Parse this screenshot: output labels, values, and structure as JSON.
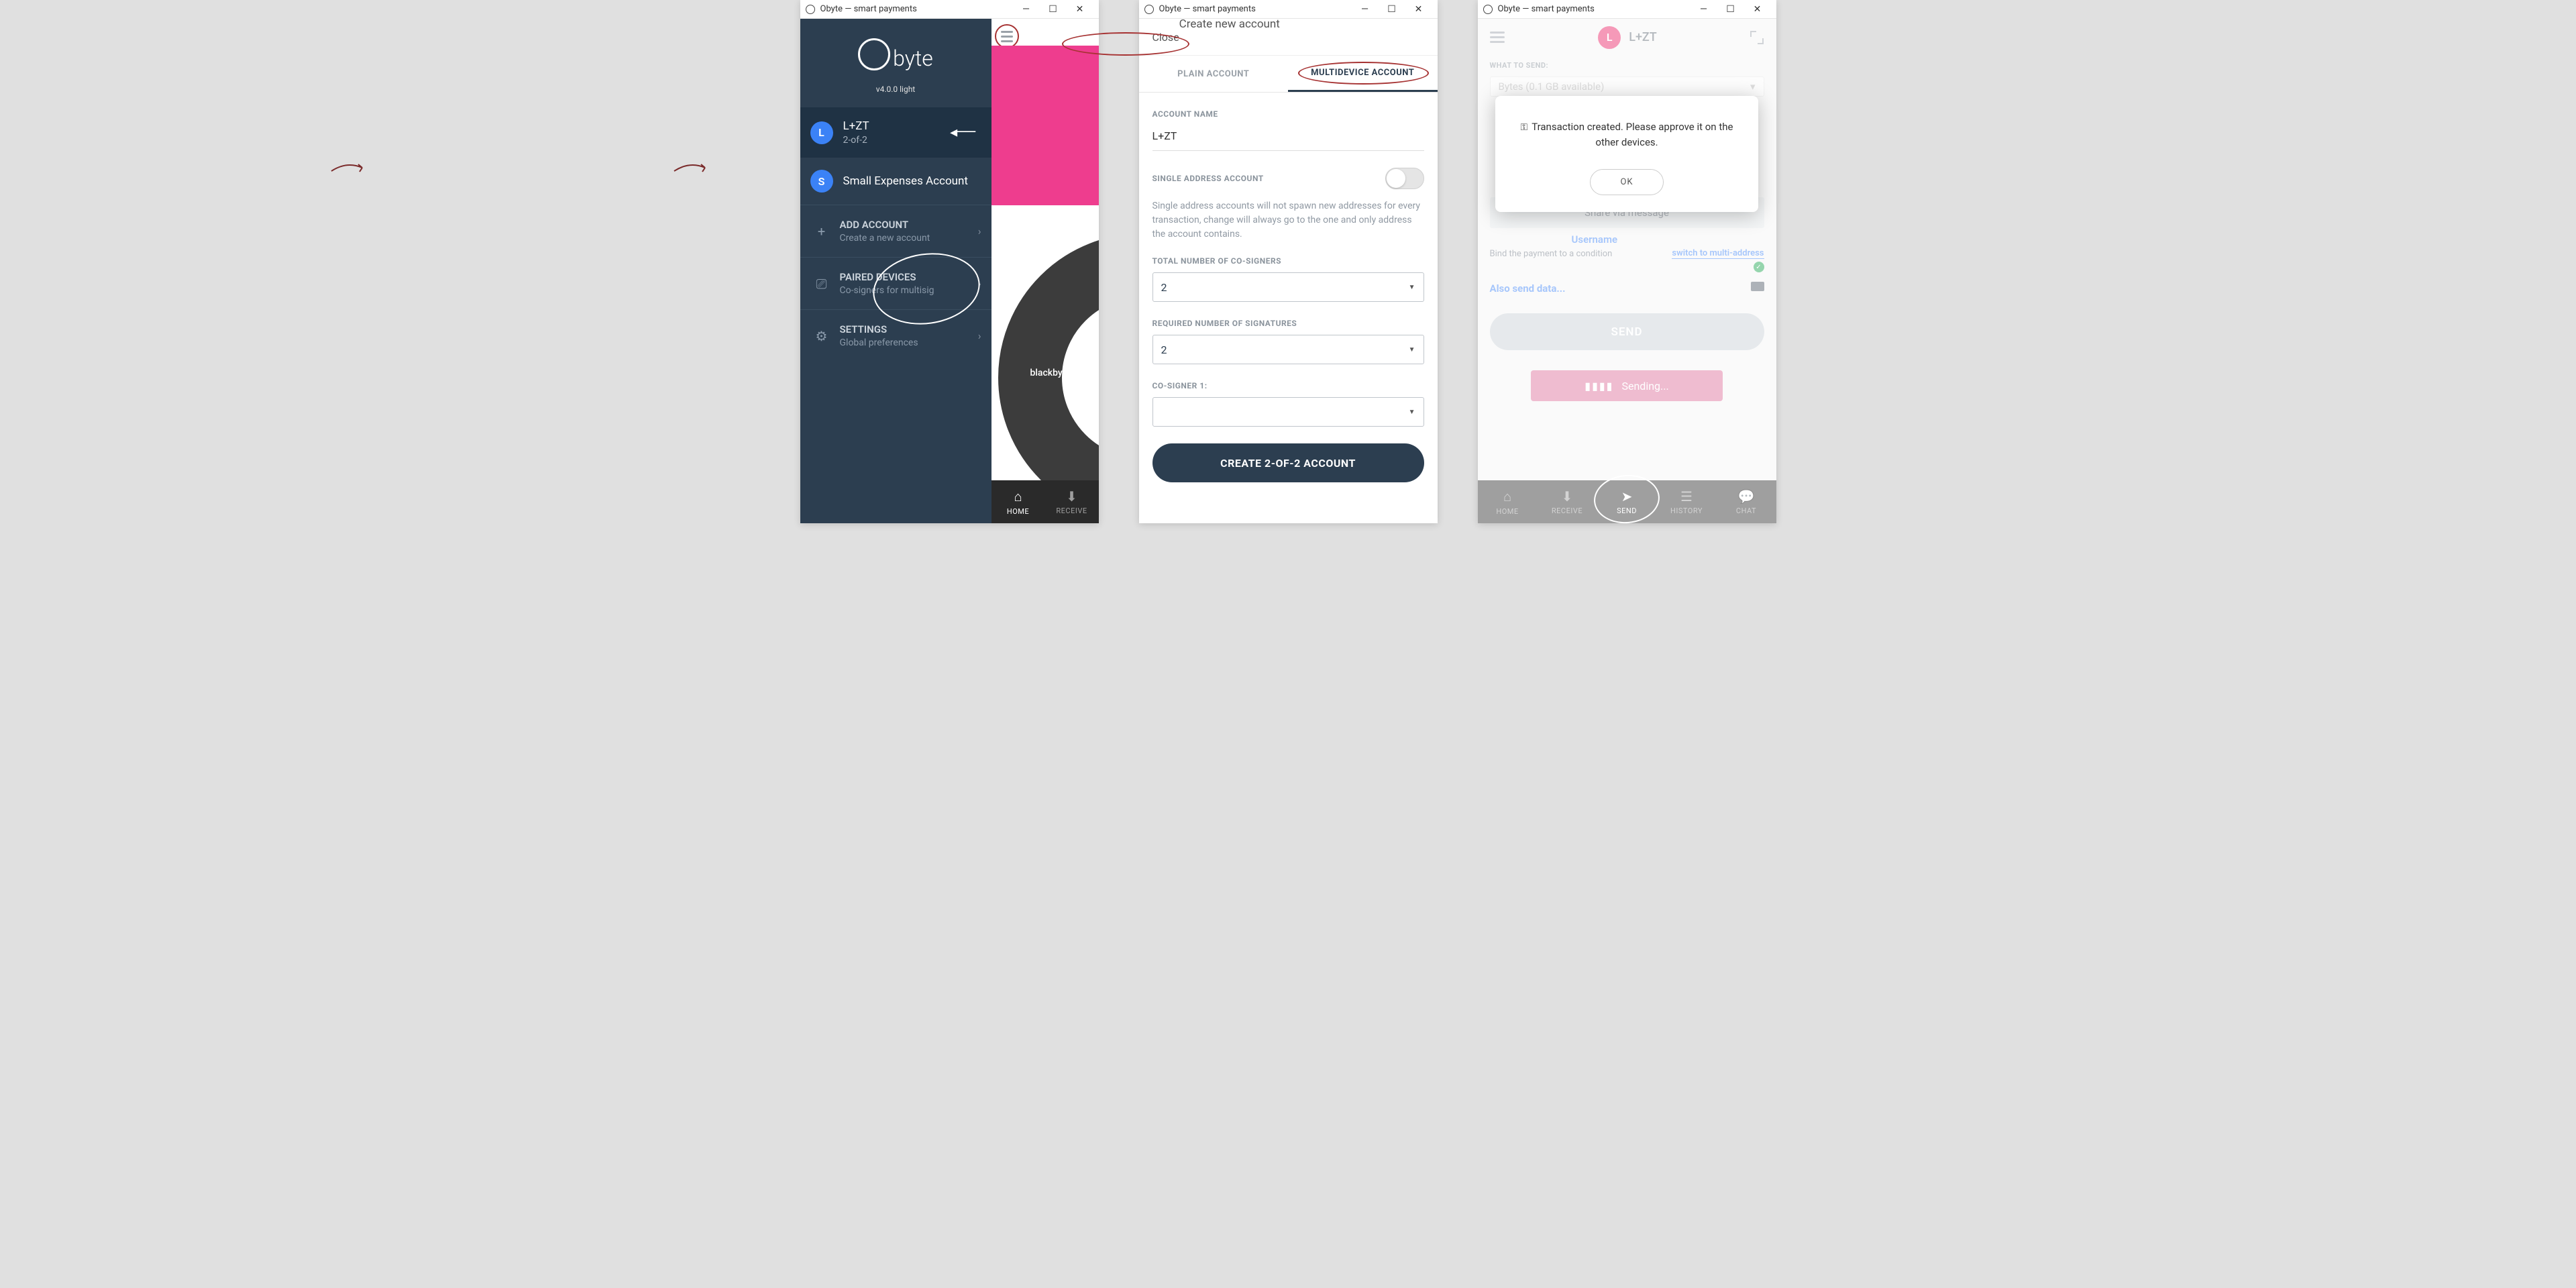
{
  "titlebar": {
    "title": "Obyte — smart payments"
  },
  "window1": {
    "logo_text": "byte",
    "version": "v4.0.0 light",
    "accounts": [
      {
        "badge": "L",
        "name": "L+ZT",
        "sub": "2-of-2",
        "selected": true
      },
      {
        "badge": "S",
        "name": "Small Expenses Account",
        "sub": "",
        "selected": false
      }
    ],
    "menu": [
      {
        "icon": "+",
        "title": "ADD ACCOUNT",
        "sub": "Create a new account"
      },
      {
        "icon": "⎚",
        "title": "PAIRED DEVICES",
        "sub": "Co-signers for multisig"
      },
      {
        "icon": "⚙",
        "title": "SETTINGS",
        "sub": "Global preferences"
      }
    ],
    "donut_label": "blackbytes",
    "nav": [
      {
        "label": "HOME",
        "active": true
      },
      {
        "label": "RECEIVE",
        "active": false
      }
    ]
  },
  "window2": {
    "close": "Close",
    "header_title": "Create new account",
    "tabs": [
      {
        "label": "PLAIN ACCOUNT",
        "active": false
      },
      {
        "label": "MULTIDEVICE ACCOUNT",
        "active": true
      }
    ],
    "form": {
      "account_name_label": "ACCOUNT NAME",
      "account_name_value": "L+ZT",
      "single_addr_label": "SINGLE ADDRESS ACCOUNT",
      "single_addr_help": "Single address accounts will not spawn new addresses for every transaction, change will always go to the one and only address the account contains.",
      "cosigners_label": "TOTAL NUMBER OF CO-SIGNERS",
      "cosigners_value": "2",
      "signatures_label": "REQUIRED NUMBER OF SIGNATURES",
      "signatures_value": "2",
      "cosigner1_label": "CO-SIGNER 1:",
      "cosigner1_value": "",
      "create_button": "CREATE 2-OF-2 ACCOUNT"
    }
  },
  "window3": {
    "header_name": "L+ZT",
    "header_badge": "L",
    "what_to_send": "WHAT TO SEND:",
    "dropdown_text": "Bytes (0.1 GB available)",
    "username": "Username",
    "share_msg": "Share via message",
    "bind_condition": "Bind the payment to a condition",
    "switch_multi": "switch to multi-address",
    "also_send": "Also send data...",
    "send_btn": "SEND",
    "sending": "Sending...",
    "modal": {
      "text": "Transaction created. Please approve it on the other devices.",
      "ok": "OK"
    },
    "nav": [
      {
        "label": "HOME",
        "active": false
      },
      {
        "label": "RECEIVE",
        "active": false
      },
      {
        "label": "SEND",
        "active": true
      },
      {
        "label": "HISTORY",
        "active": false
      },
      {
        "label": "CHAT",
        "active": false
      }
    ]
  }
}
